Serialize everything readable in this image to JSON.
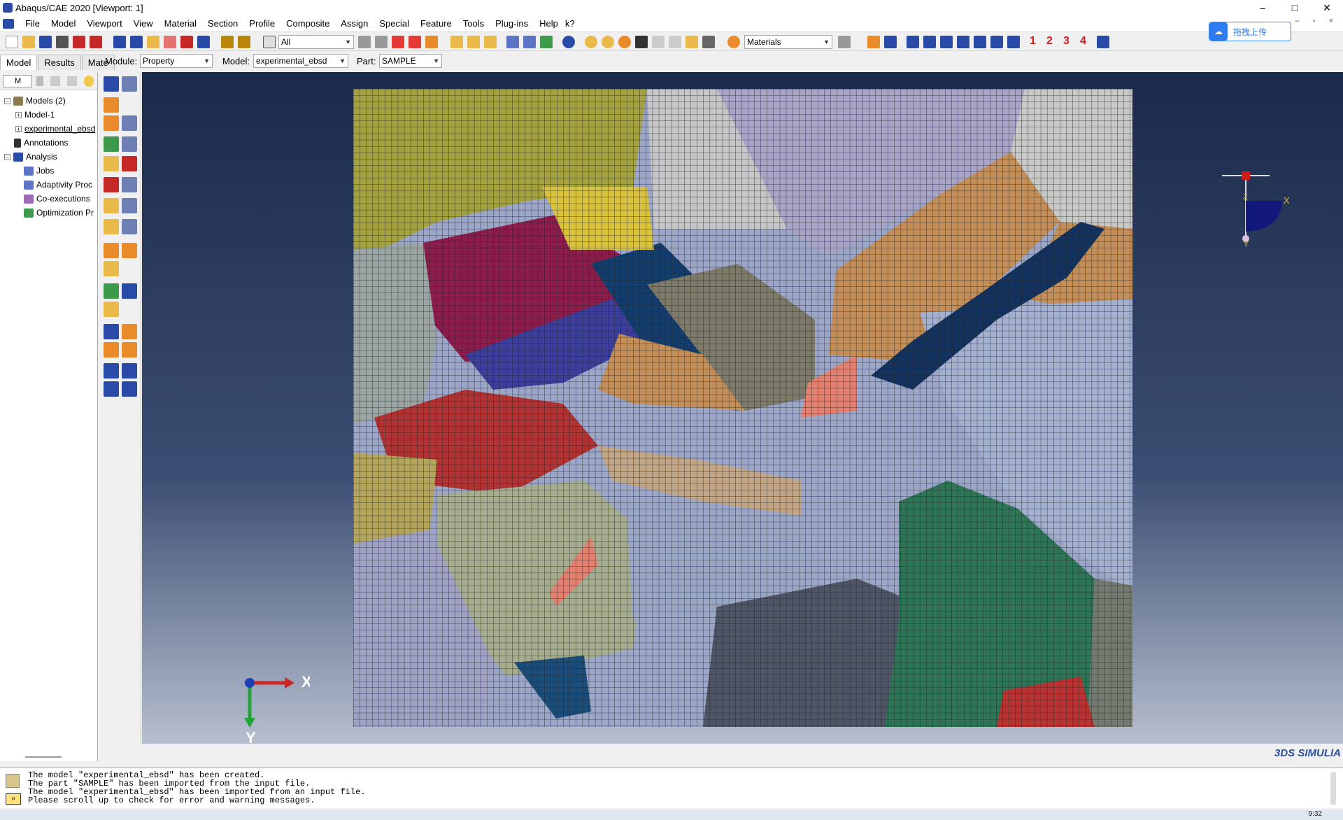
{
  "window": {
    "title": "Abaqus/CAE 2020 [Viewport: 1]",
    "controls": [
      "–",
      "□",
      "✕"
    ]
  },
  "menubar": {
    "items": [
      "File",
      "Model",
      "Viewport",
      "View",
      "Material",
      "Section",
      "Profile",
      "Composite",
      "Assign",
      "Special",
      "Feature",
      "Tools",
      "Plug-ins",
      "Help"
    ],
    "help_icon": "k?"
  },
  "toolbar": {
    "selection_filter": "All",
    "render_style": "Materials",
    "view_numbers": [
      "1",
      "2",
      "3",
      "4"
    ]
  },
  "upload_button": {
    "label": "拖拽上传",
    "icon": "cloud-icon"
  },
  "tabs": [
    "Model",
    "Results",
    "Mate"
  ],
  "context": {
    "module_label": "Module:",
    "module_value": "Property",
    "model_label": "Model:",
    "model_value": "experimental_ebsd",
    "part_label": "Part:",
    "part_value": "SAMPLE"
  },
  "tree": {
    "filter_value": "M",
    "items": [
      {
        "label": "Models (2)",
        "level": 0,
        "expander": "–"
      },
      {
        "label": "Model-1",
        "level": 1,
        "expander": "+"
      },
      {
        "label": "experimental_ebsd",
        "level": 1,
        "expander": "+"
      },
      {
        "label": "Annotations",
        "level": 0,
        "expander": ""
      },
      {
        "label": "Analysis",
        "level": 0,
        "expander": "–"
      },
      {
        "label": "Jobs",
        "level": 1,
        "expander": ""
      },
      {
        "label": "Adaptivity Proc",
        "level": 1,
        "expander": ""
      },
      {
        "label": "Co-executions",
        "level": 1,
        "expander": ""
      },
      {
        "label": "Optimization Pr",
        "level": 1,
        "expander": ""
      }
    ]
  },
  "triad": {
    "x_label": "X",
    "y_label": "Y"
  },
  "mini_triad": {
    "x_label": "X",
    "y_label": "Y",
    "z_label": "Z"
  },
  "messages": [
    "The model \"experimental_ebsd\" has been created.",
    "The part \"SAMPLE\" has been imported from the input file.",
    "The model \"experimental_ebsd\" has been imported from an input file.",
    "Please scroll up to check for error and warning messages."
  ],
  "logo": "3DS SIMULIA",
  "taskbar": {
    "time": "9:32"
  }
}
